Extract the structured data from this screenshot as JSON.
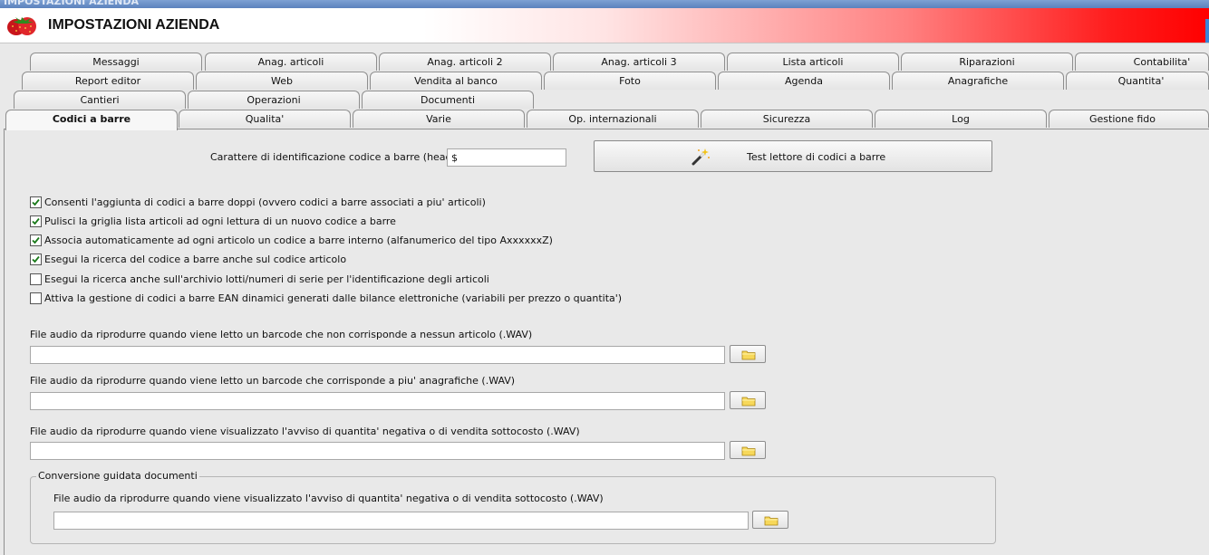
{
  "window": {
    "title": "IMPOSTAZIONI AZIENDA",
    "header_title": "IMPOSTAZIONI AZIENDA",
    "colors": {
      "header_gradient_end": "#ff0000",
      "title_bar": "#6b8fc8",
      "panel_bg": "#e9e9e9"
    }
  },
  "tabs": {
    "row1": [
      "Messaggi",
      "Anag. articoli",
      "Anag. articoli 2",
      "Anag. articoli 3",
      "Lista articoli",
      "Riparazioni",
      "Contabilita'"
    ],
    "row2": [
      "Report editor",
      "Web",
      "Vendita al banco",
      "Foto",
      "Agenda",
      "Anagrafiche",
      "Quantita'"
    ],
    "row3": [
      "Cantieri",
      "Operazioni",
      "Documenti"
    ],
    "row4": [
      "Codici a barre",
      "Qualita'",
      "Varie",
      "Op. internazionali",
      "Sicurezza",
      "Log",
      "Gestione fido"
    ],
    "active": "Codici a barre"
  },
  "barcode": {
    "header_label": "Carattere di identificazione codice a barre (header) :",
    "header_value": "$",
    "test_button_label": "Test lettore di codici a barre"
  },
  "options": [
    {
      "label": "Consenti l'aggiunta di codici a barre doppi (ovvero codici a barre associati a piu' articoli)",
      "checked": true
    },
    {
      "label": "Pulisci la griglia lista articoli ad ogni lettura di un nuovo codice a barre",
      "checked": true
    },
    {
      "label": "Associa automaticamente ad ogni articolo un codice a barre interno (alfanumerico del tipo AxxxxxxZ)",
      "checked": true
    },
    {
      "label": "Esegui la ricerca del codice a barre anche sul codice articolo",
      "checked": true
    },
    {
      "label": "Esegui la ricerca anche sull'archivio lotti/numeri di serie per l'identificazione degli articoli",
      "checked": false
    },
    {
      "label": "Attiva la gestione di codici a barre EAN dinamici generati dalle bilance elettroniche (variabili per prezzo o quantita')",
      "checked": false
    }
  ],
  "audio_files": [
    {
      "label": "File audio da riprodurre quando viene letto un barcode che non corrisponde a nessun articolo (.WAV)",
      "value": ""
    },
    {
      "label": "File audio da riprodurre quando viene letto un barcode che corrisponde a piu' anagrafiche (.WAV)",
      "value": ""
    },
    {
      "label": "File audio da riprodurre quando viene visualizzato l'avviso di quantita' negativa o di vendita sottocosto (.WAV)",
      "value": ""
    }
  ],
  "conversion_group": {
    "title": "Conversione guidata documenti",
    "label": "File audio da riprodurre quando viene visualizzato l'avviso di quantita' negativa o di vendita sottocosto (.WAV)",
    "value": ""
  },
  "icons": {
    "logo": "strawberry-icon",
    "wand": "magic-wand-icon",
    "folder": "folder-icon"
  }
}
